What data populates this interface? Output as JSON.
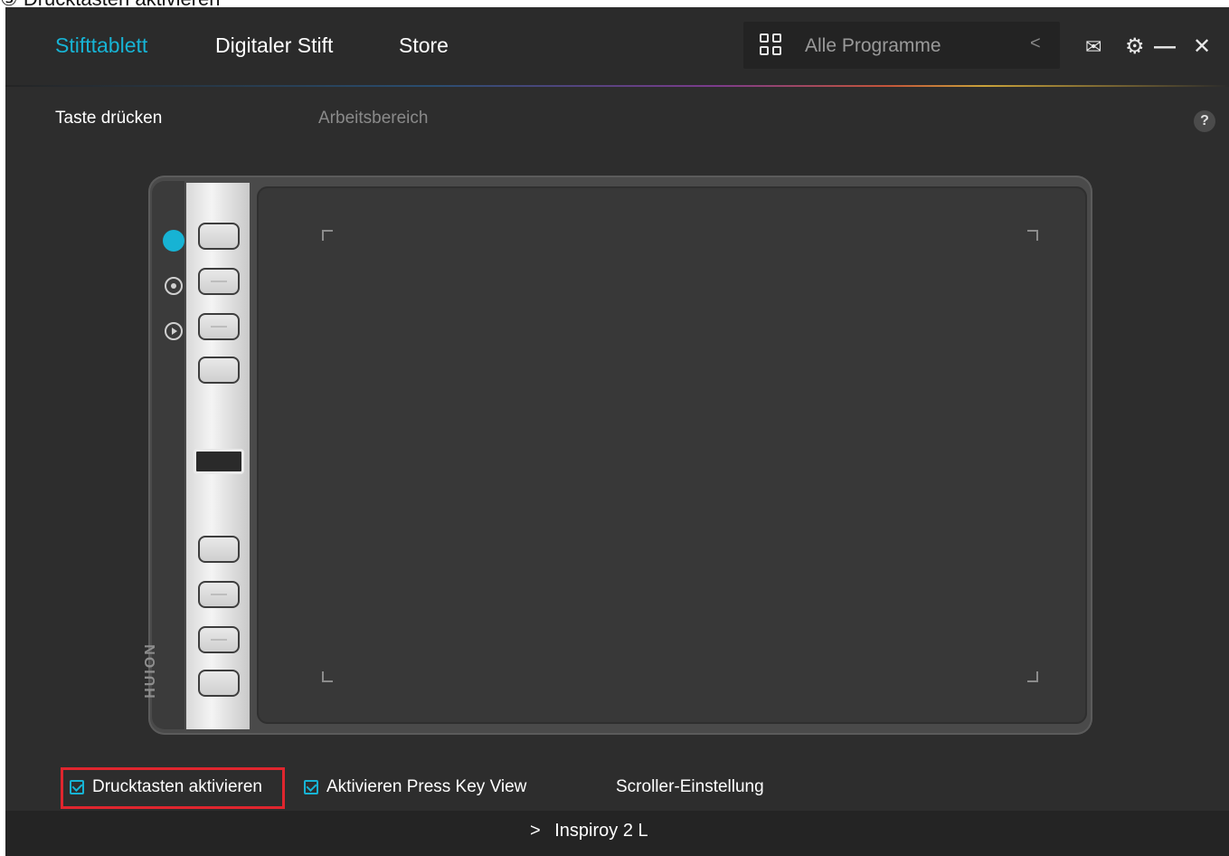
{
  "caption": "③ Drucktasten aktivieren",
  "header": {
    "tabs": [
      {
        "label": "Stifttablett",
        "active": true
      },
      {
        "label": "Digitaler Stift",
        "active": false
      },
      {
        "label": "Store",
        "active": false
      }
    ],
    "program_select": {
      "icon": "grid-icon",
      "value": "Alle Programme",
      "chevron": "<"
    },
    "icons": {
      "mail": "✉",
      "settings": "⚙",
      "minimize": "—",
      "close": "✕"
    }
  },
  "subnav": {
    "tabs": [
      {
        "label": "Taste drücken",
        "active": true
      },
      {
        "label": "Arbeitsbereich",
        "active": false
      }
    ],
    "help": "?"
  },
  "tablet": {
    "brand": "HUION",
    "active_indicator_color": "#17b3d4"
  },
  "options": {
    "enable_keys": {
      "label": "Drucktasten aktivieren",
      "checked": true
    },
    "press_key_view": {
      "label": "Aktivieren Press Key View",
      "checked": true
    },
    "scroller": {
      "label": "Scroller-Einstellung"
    }
  },
  "footer": {
    "device": "Inspiroy 2 L",
    "chevron": ">"
  },
  "colors": {
    "accent": "#17b3d4",
    "highlight": "#e0262e",
    "background": "#2d2d2d"
  }
}
